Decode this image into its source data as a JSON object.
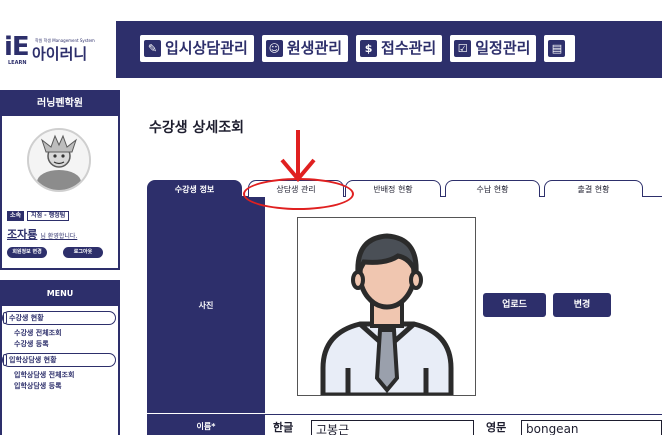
{
  "brand": {
    "logo_big": "iE",
    "logo_sub": "학원 학생 Management System",
    "logo_korean": "아이러니",
    "logo_learn": "LEARN"
  },
  "top_nav": [
    {
      "icon": "pencil-icon",
      "glyph": "✎",
      "label": "입시상담관리"
    },
    {
      "icon": "user-icon",
      "glyph": "☺",
      "label": "원생관리"
    },
    {
      "icon": "dollar-icon",
      "glyph": "$",
      "label": "접수관리"
    },
    {
      "icon": "checklist-icon",
      "glyph": "☑",
      "label": "일정관리"
    },
    {
      "icon": "document-icon",
      "glyph": "▤",
      "label": ""
    }
  ],
  "sidebar": {
    "academy_name": "러닝펜학원",
    "role_badge": "소속",
    "role_text": "지점 - 행정팀",
    "user_name": "조자룡",
    "user_greeting": "님 환영합니다.",
    "btn_profile": "회원정보 변경",
    "btn_logout": "로그아웃",
    "menu_title": "MENU",
    "menu_groups": [
      {
        "label": "수강생 현황",
        "items": [
          "수강생 전체조회",
          "수강생 등록"
        ]
      },
      {
        "label": "입학상담생 현황",
        "items": [
          "입학상담생 전체조회",
          "입학상담생 등록"
        ]
      }
    ]
  },
  "main": {
    "page_title": "수강생 상세조회",
    "tabs": [
      "수강생 정보",
      "상담생 관리",
      "반배정 현황",
      "수납 현황",
      "출결 현황"
    ],
    "active_tab": 0,
    "photo_label": "사진",
    "upload_button": "업로드",
    "change_button": "변경",
    "name_label": "이름*",
    "korean_label": "한글",
    "korean_value": "고봉근",
    "english_label": "영문",
    "english_value": "bongean"
  },
  "colors": {
    "brand": "#2d2f6b",
    "annotation": "#e02020"
  }
}
